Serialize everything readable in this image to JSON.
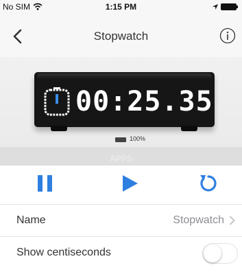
{
  "status_bar": {
    "carrier": "No SIM",
    "time": "1:15 PM",
    "icons": [
      "wifi-icon",
      "location-icon",
      "battery-icon"
    ]
  },
  "nav": {
    "title": "Stopwatch",
    "back_icon": "chevron-left-icon",
    "info_icon": "info-icon"
  },
  "device": {
    "display_time": "00:25.35",
    "battery_label": "100%",
    "section_label": "APPS"
  },
  "controls": {
    "pause_icon": "pause-icon",
    "play_icon": "play-icon",
    "reset_icon": "reset-icon",
    "accent_color": "#2f7fe0"
  },
  "settings": {
    "name_label": "Name",
    "name_value": "Stopwatch",
    "centiseconds_label": "Show centiseconds",
    "centiseconds_enabled": false
  }
}
